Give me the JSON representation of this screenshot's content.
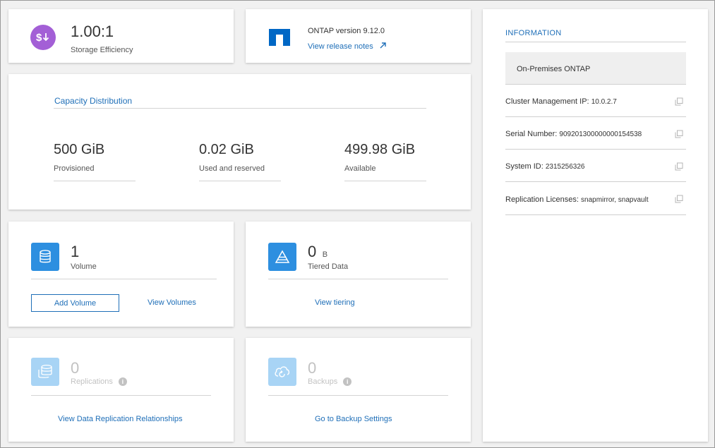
{
  "efficiency": {
    "value": "1.00:1",
    "label": "Storage Efficiency",
    "icon": "dollar-down-icon",
    "color": "#a35fd6"
  },
  "ontap": {
    "version": "ONTAP version 9.12.0",
    "release_notes": "View release notes",
    "logo": "netapp-logo"
  },
  "capacity": {
    "title": "Capacity Distribution",
    "items": [
      {
        "value": "500 GiB",
        "label": "Provisioned"
      },
      {
        "value": "0.02 GiB",
        "label": "Used and reserved"
      },
      {
        "value": "499.98 GiB",
        "label": "Available"
      }
    ]
  },
  "volume": {
    "count": "1",
    "label": "Volume",
    "add_button": "Add Volume",
    "view_link": "View Volumes",
    "icon": "database-icon"
  },
  "tiered": {
    "value": "0",
    "unit": "B",
    "label": "Tiered Data",
    "view_link": "View tiering",
    "icon": "pyramid-icon"
  },
  "replications": {
    "value": "0",
    "label": "Replications",
    "link": "View Data Replication Relationships",
    "icon": "replication-icon"
  },
  "backups": {
    "value": "0",
    "label": "Backups",
    "link": "Go to Backup Settings",
    "icon": "cloud-backup-icon"
  },
  "information": {
    "heading": "INFORMATION",
    "type": "On-Premises ONTAP",
    "rows": [
      {
        "key": "Cluster Management IP:",
        "value": "10.0.2.7"
      },
      {
        "key": "Serial Number:",
        "value": "909201300000000154538"
      },
      {
        "key": "System ID:",
        "value": "2315256326"
      },
      {
        "key": "Replication Licenses:",
        "value": "snapmirror, snapvault"
      }
    ]
  },
  "colors": {
    "accent": "#1f6fb8",
    "icon_blue": "#2d8fe0",
    "icon_blue_faded": "#a8d4f5",
    "purple": "#a35fd6"
  }
}
